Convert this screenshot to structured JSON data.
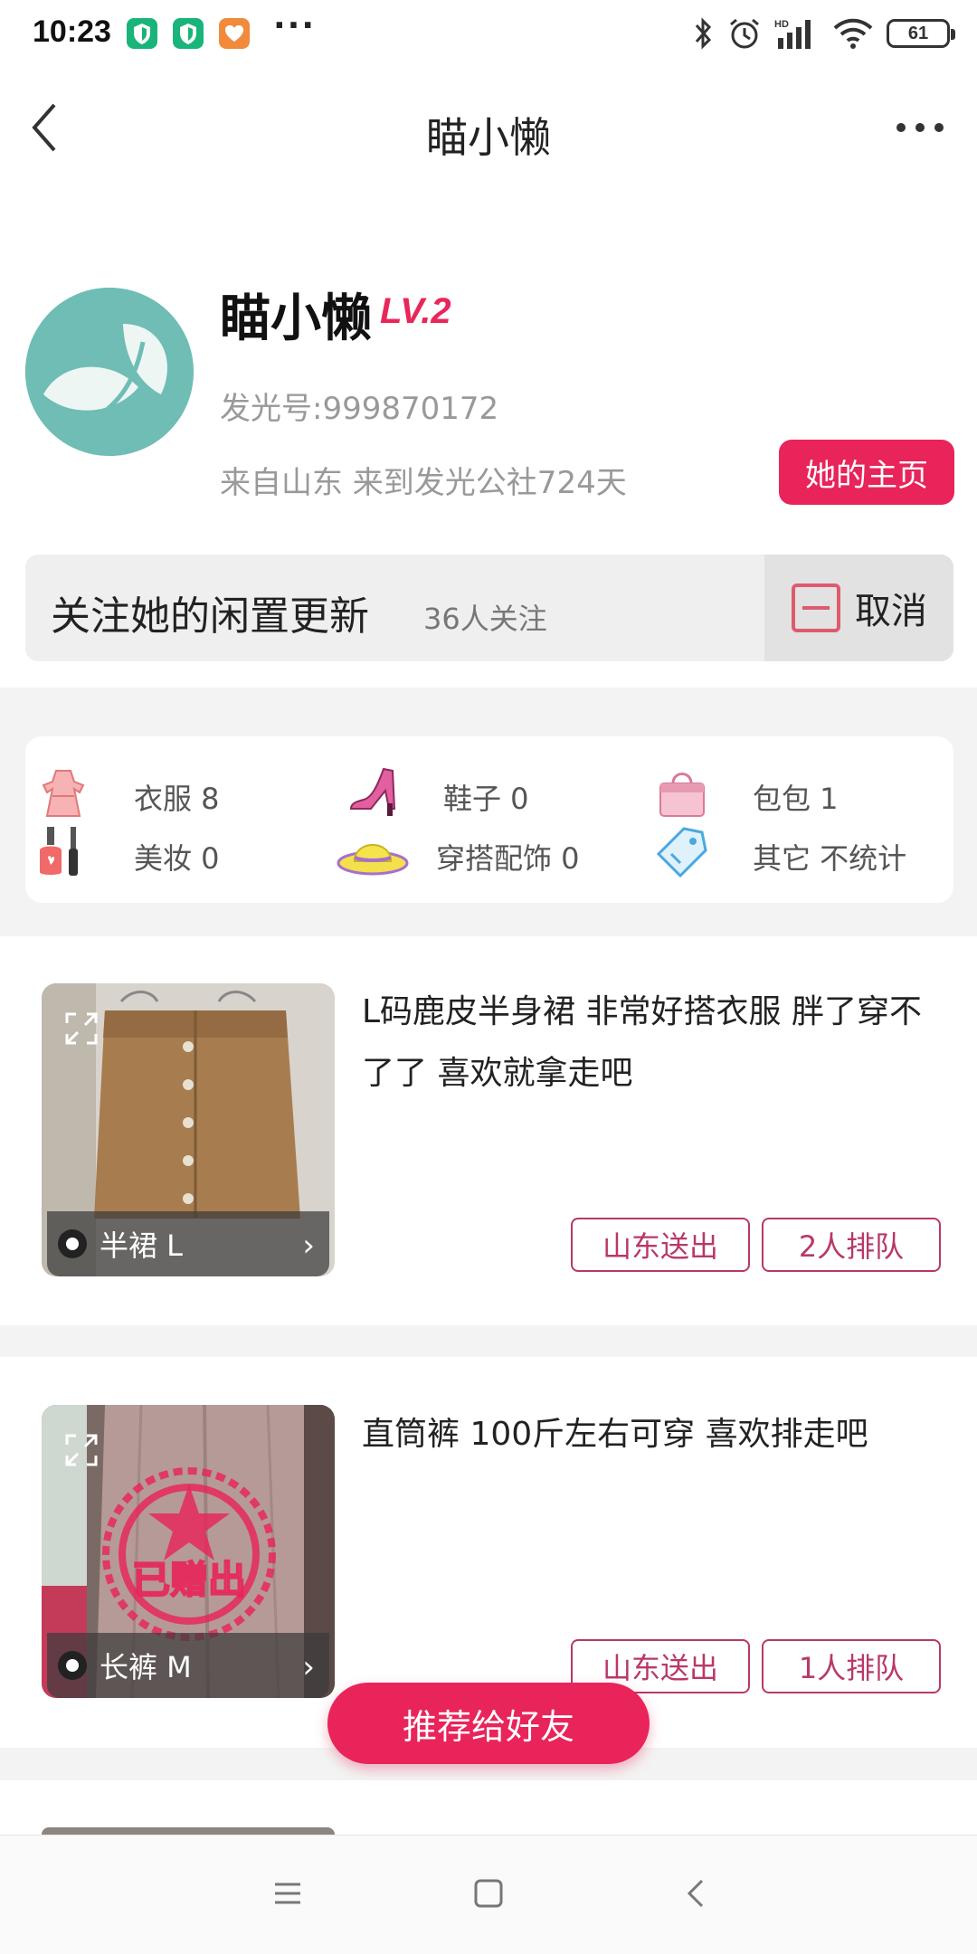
{
  "status_bar": {
    "time": "10:23",
    "battery": "61",
    "icons": [
      "shield-app-icon",
      "shield-app-icon",
      "heart-app-icon",
      "more-dots",
      "bluetooth-icon",
      "alarm-icon",
      "signal-icon",
      "wifi-icon",
      "battery-icon"
    ]
  },
  "nav": {
    "title": "瞄小懒",
    "back_icon": "chevron-left-icon",
    "more_icon": "more-horizontal-icon"
  },
  "profile": {
    "name": "瞄小懒",
    "level": "LV.2",
    "id_line": "发光号:999870172",
    "origin_line": "来自山东 来到发光公社724天",
    "homepage_button": "她的主页"
  },
  "follow": {
    "text": "关注她的闲置更新",
    "count": "36人关注",
    "cancel_label": "取消"
  },
  "categories": [
    {
      "icon": "dress-icon",
      "label": "衣服 8"
    },
    {
      "icon": "high-heel-icon",
      "label": "鞋子 0"
    },
    {
      "icon": "handbag-icon",
      "label": "包包 1"
    },
    {
      "icon": "nail-polish-icon",
      "label": "美妆 0"
    },
    {
      "icon": "sun-hat-icon",
      "label": "穿搭配饰 0"
    },
    {
      "icon": "tag-icon",
      "label": "其它 不统计"
    }
  ],
  "listings": [
    {
      "title": "L码鹿皮半身裙 非常好搭衣服 胖了穿不了了 喜欢就拿走吧",
      "thumb_label": "半裙 L",
      "location_tag": "山东送出",
      "queue_tag": "2人排队",
      "gifted": false
    },
    {
      "title": "直筒裤 100斤左右可穿 喜欢排走吧",
      "thumb_label": "长裤 M",
      "location_tag": "山东送出",
      "queue_tag": "1人排队",
      "gifted": true,
      "stamp_text": "已赠出"
    }
  ],
  "recommend_button": "推荐给好友",
  "colors": {
    "accent": "#e8245a",
    "tag_border": "#b8386a",
    "avatar_bg": "#6fbdb4"
  }
}
